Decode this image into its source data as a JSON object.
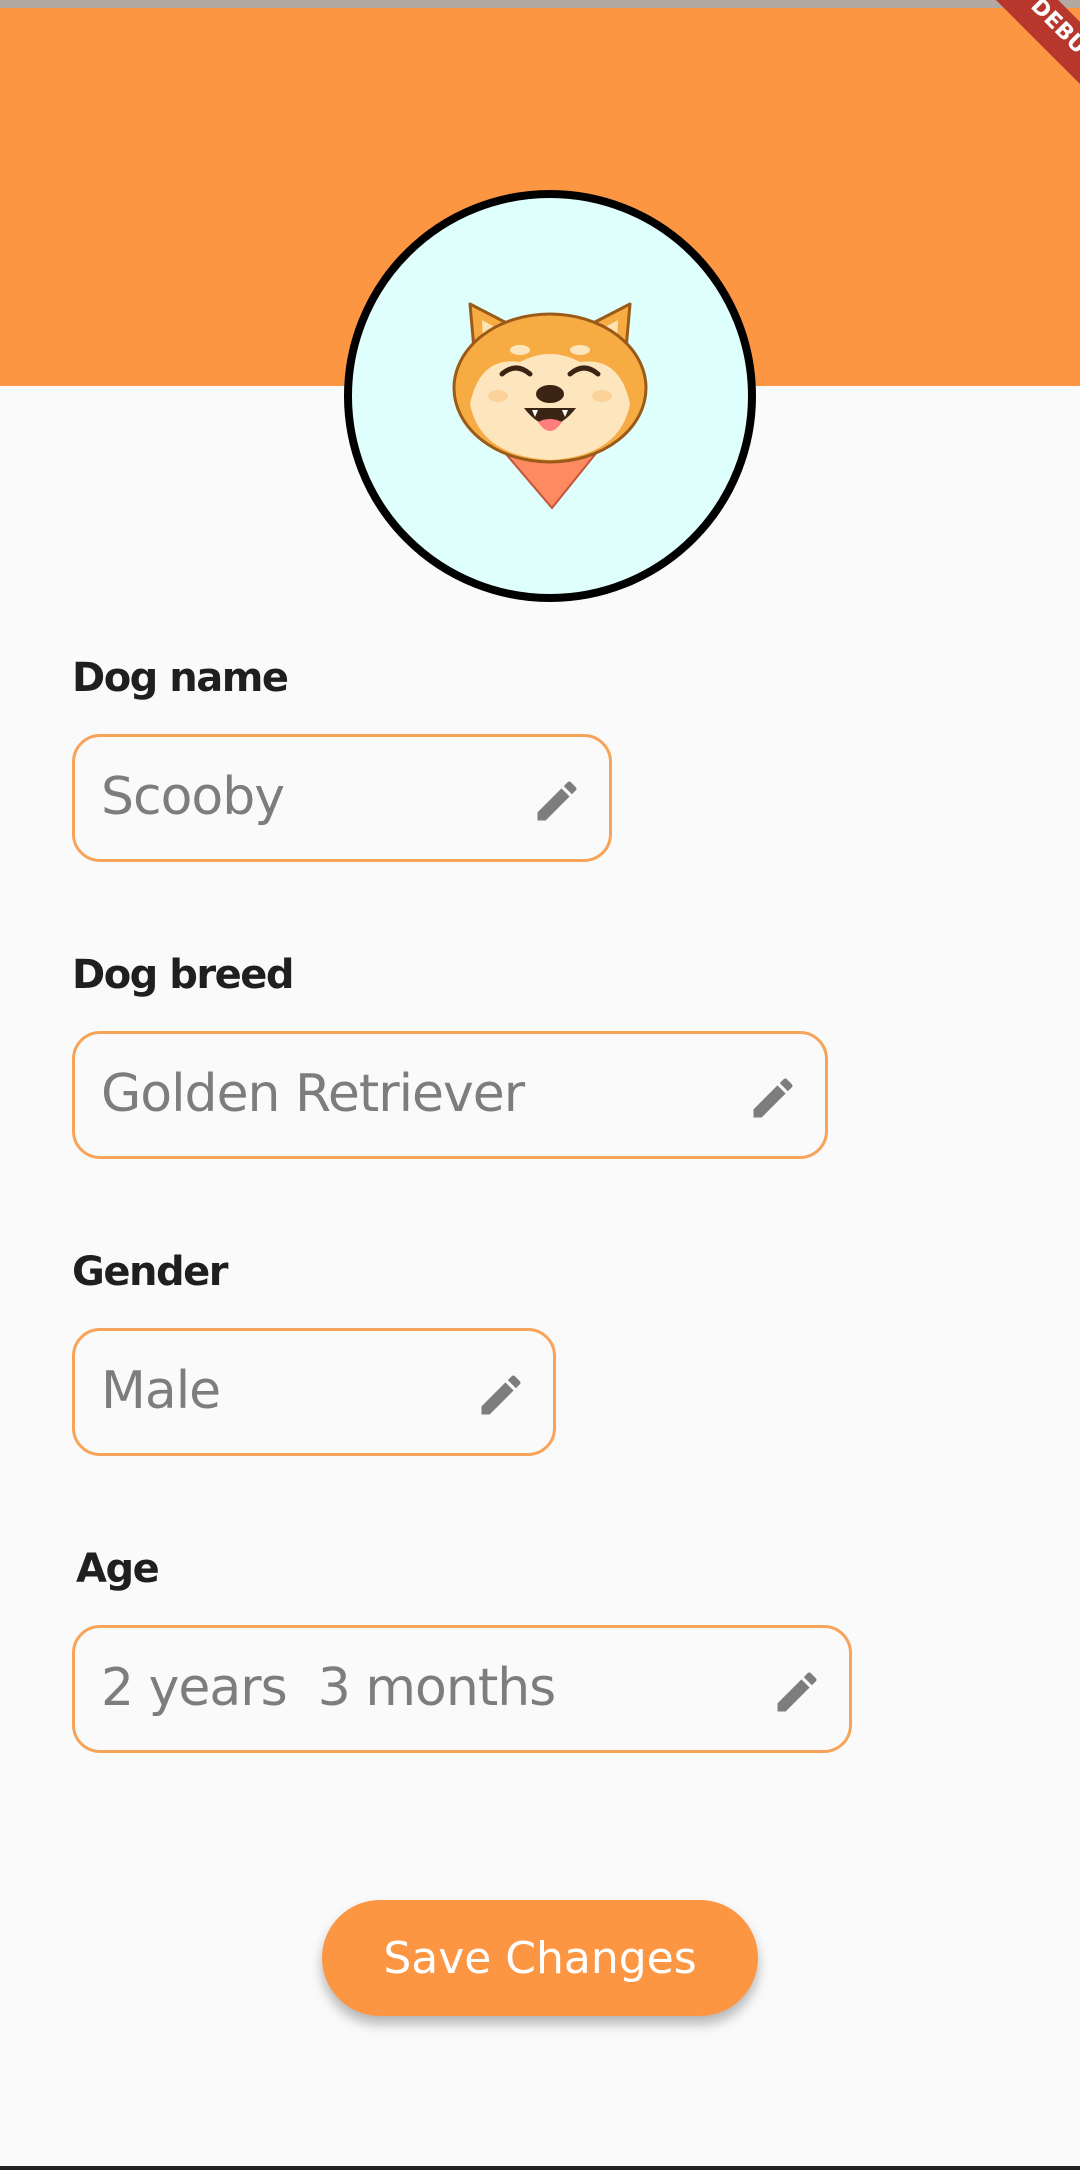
{
  "colors": {
    "accent": "#fd9643",
    "avatar_bg": "#dffffd",
    "field_border": "#f7a45a",
    "debug_banner": "#b8372d"
  },
  "debug_banner": {
    "label": "DEBUG"
  },
  "profile": {
    "avatar_icon": "shiba-dog-avatar"
  },
  "form": {
    "dog_name": {
      "label": "Dog name",
      "value": "Scooby",
      "icon": "pencil-icon"
    },
    "dog_breed": {
      "label": "Dog breed",
      "value": "Golden Retriever",
      "icon": "pencil-icon"
    },
    "gender": {
      "label": "Gender",
      "value": "Male",
      "icon": "pencil-icon"
    },
    "age": {
      "label": "Age",
      "value": "2 years  3 months",
      "icon": "pencil-icon"
    }
  },
  "actions": {
    "save_label": "Save Changes"
  }
}
